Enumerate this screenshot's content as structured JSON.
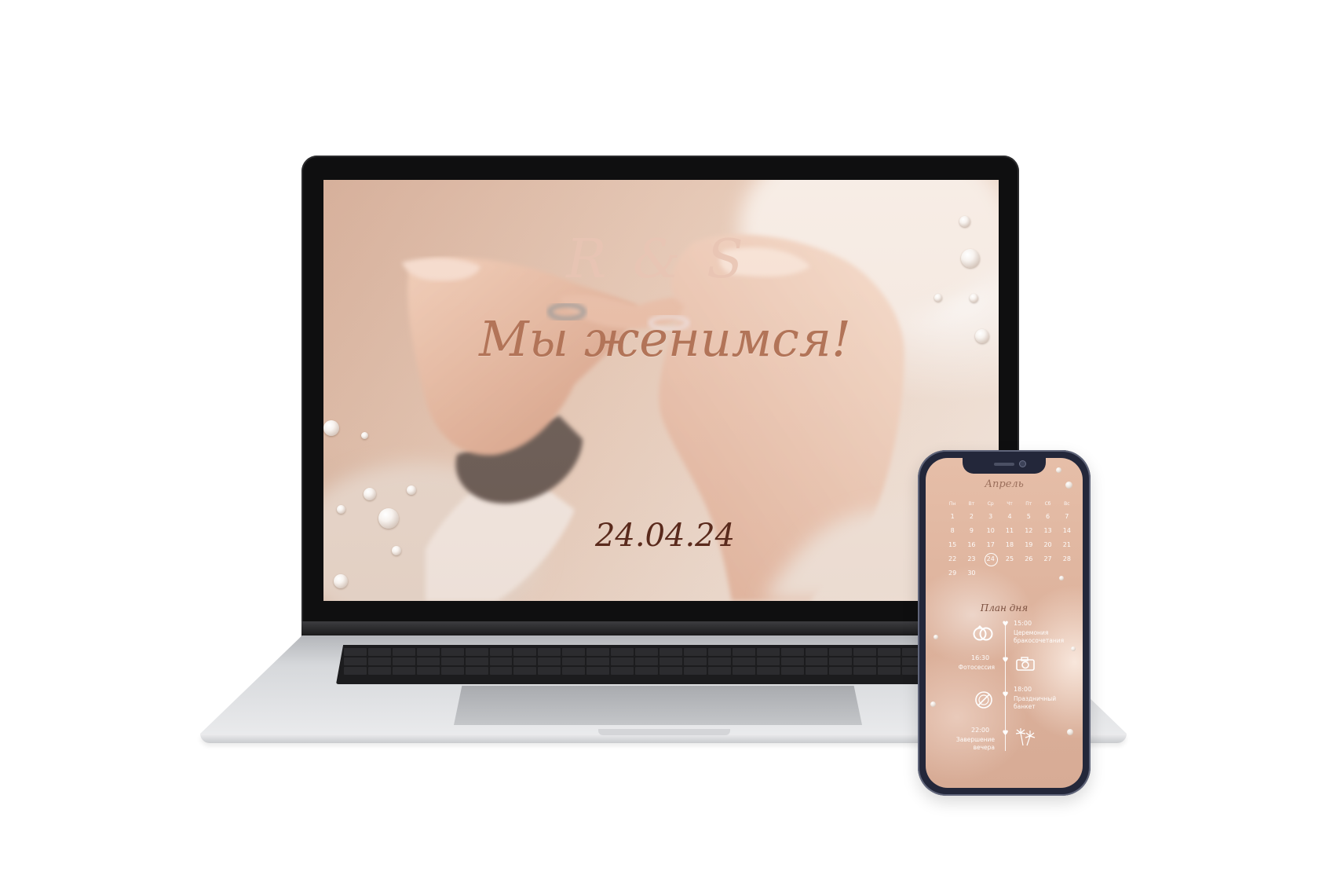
{
  "laptop_screen": {
    "monogram": "R & S",
    "headline": "Мы женимся!",
    "date": "24.04.24"
  },
  "phone_screen": {
    "calendar": {
      "month": "Апрель",
      "weekdays": [
        "Пн",
        "Вт",
        "Ср",
        "Чт",
        "Пт",
        "Сб",
        "Вс"
      ],
      "weeks": [
        [
          "1",
          "2",
          "3",
          "4",
          "5",
          "6",
          "7"
        ],
        [
          "8",
          "9",
          "10",
          "11",
          "12",
          "13",
          "14"
        ],
        [
          "15",
          "16",
          "17",
          "18",
          "19",
          "20",
          "21"
        ],
        [
          "22",
          "23",
          "24",
          "25",
          "26",
          "27",
          "28"
        ],
        [
          "29",
          "30",
          "",
          "",
          "",
          "",
          ""
        ]
      ],
      "highlighted_day": "24"
    },
    "plan": {
      "title": "План дня",
      "events": [
        {
          "time": "15:00",
          "label": "Церемония бракосочетания",
          "icon": "rings-icon"
        },
        {
          "time": "16:30",
          "label": "Фотосессия",
          "icon": "camera-icon"
        },
        {
          "time": "18:00",
          "label": "Праздничный банкет",
          "icon": "plate-icon"
        },
        {
          "time": "22:00",
          "label": "Завершение вечера",
          "icon": "fireworks-icon"
        }
      ]
    }
  },
  "colors": {
    "headline": "#b27458",
    "date": "#5a2a1c",
    "monogram": "#e8c4b4",
    "phone_bg": "#ddb29c"
  }
}
